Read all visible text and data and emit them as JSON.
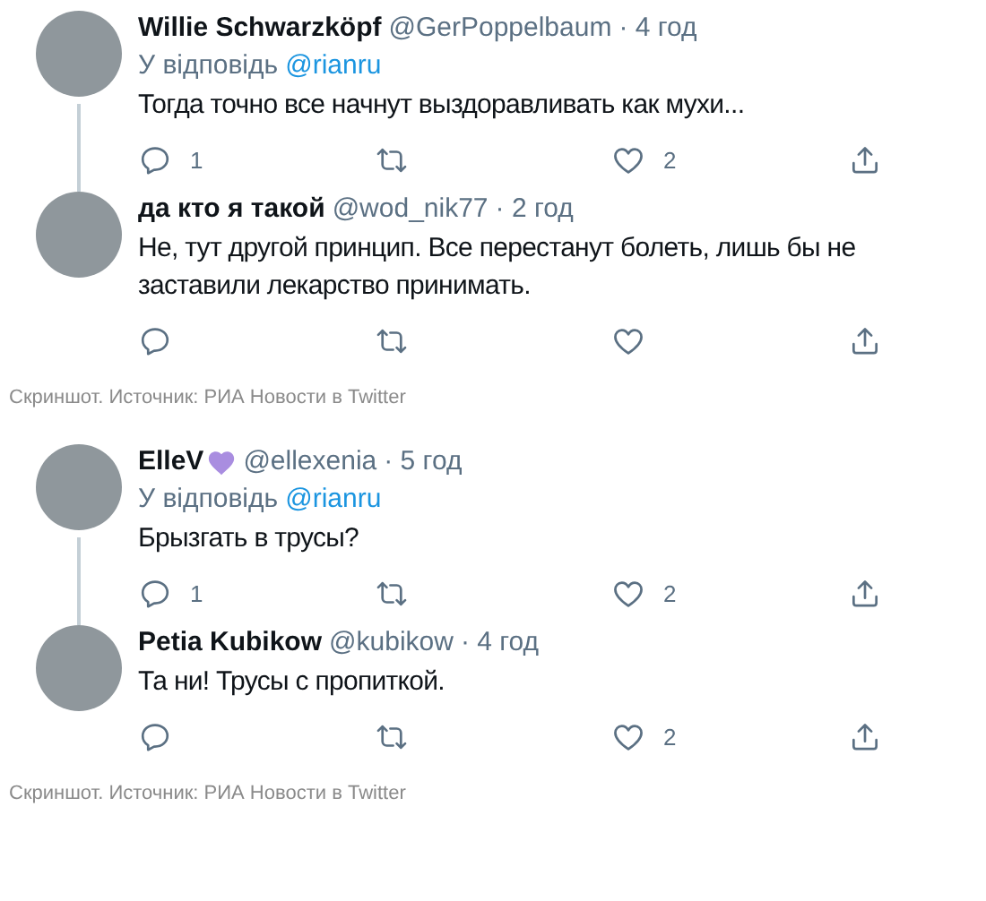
{
  "sections": [
    {
      "tweets": [
        {
          "name": "Willie Schwarzköpf",
          "handle": "@GerPoppelbaum",
          "time": "· 4 год",
          "reply_prefix": "У відповідь",
          "reply_to": "@rianru",
          "text": "Тогда точно все начнут выздоравливать как мухи...",
          "thread_line": true,
          "replies": "1",
          "likes": "2"
        },
        {
          "name": "да кто я такой",
          "handle": "@wod_nik77",
          "time": "· 2 год",
          "text": "Не, тут другой принцип. Все перестанут болеть, лишь бы не заставили лекарство принимать."
        }
      ],
      "caption": "Скриншот. Источник: РИА Новости в Twitter"
    },
    {
      "tweets": [
        {
          "name": "ElleV",
          "heart_badge": true,
          "handle": "@ellexenia",
          "time": "· 5 год",
          "reply_prefix": "У відповідь",
          "reply_to": "@rianru",
          "text": "Брызгать в трусы?",
          "thread_line": true,
          "replies": "1",
          "likes": "2"
        },
        {
          "name": "Petia Kubikow",
          "handle": "@kubikow",
          "time": "· 4 год",
          "text": "Та ни! Трусы с пропиткой.",
          "likes": "2"
        }
      ],
      "caption": "Скриншот. Источник: РИА Новости в Twitter"
    }
  ]
}
